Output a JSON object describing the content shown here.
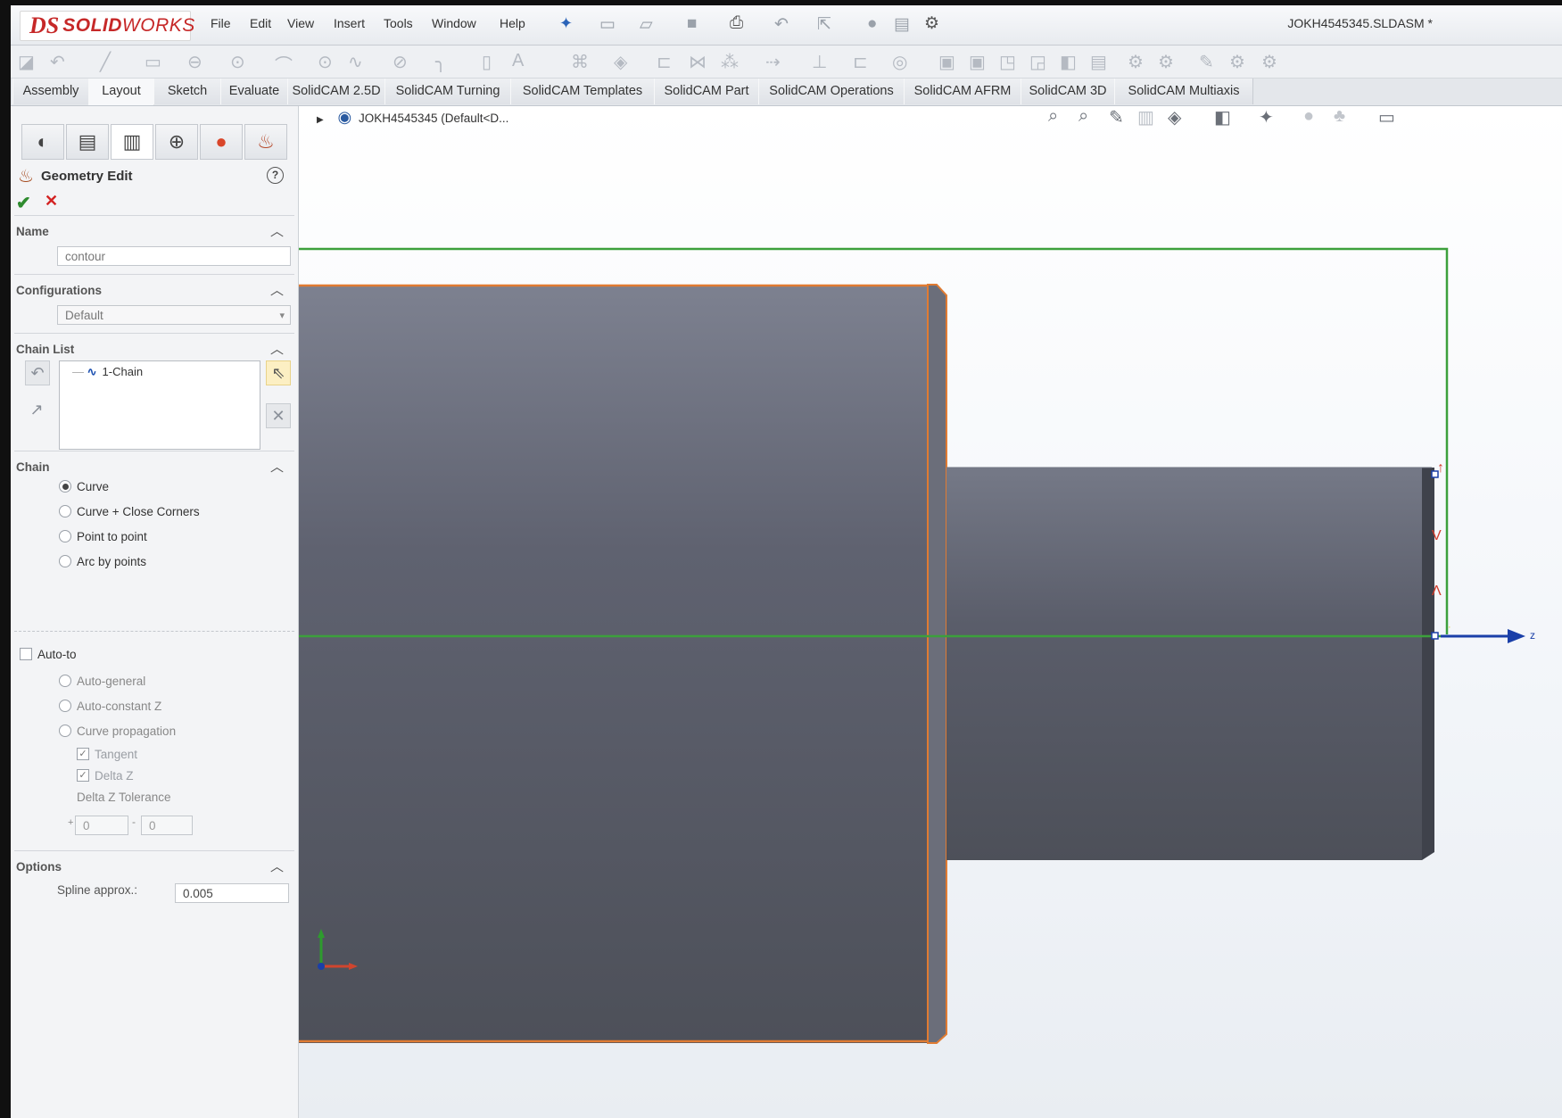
{
  "app": {
    "logo_ds": "DS",
    "logo_solid": "SOLID",
    "logo_works": "WORKS",
    "menu": [
      "File",
      "Edit",
      "View",
      "Insert",
      "Tools",
      "Window",
      "Help"
    ],
    "document_title": "JOKH4545345.SLDASM *"
  },
  "command_tabs": [
    "Assembly",
    "Layout",
    "Sketch",
    "Evaluate",
    "SolidCAM 2.5D",
    "SolidCAM Turning",
    "SolidCAM Templates",
    "SolidCAM Part",
    "SolidCAM Operations",
    "SolidCAM AFRM",
    "SolidCAM 3D",
    "SolidCAM Multiaxis"
  ],
  "active_tab": "Layout",
  "panel": {
    "title": "Geometry Edit",
    "name_section": {
      "label": "Name",
      "value": "contour"
    },
    "config_section": {
      "label": "Configurations",
      "value": "Default"
    },
    "chain_list": {
      "label": "Chain List",
      "items": [
        "1-Chain"
      ]
    },
    "chain": {
      "label": "Chain",
      "options": [
        "Curve",
        "Curve + Close Corners",
        "Point to point",
        "Arc by points"
      ],
      "selected": "Curve"
    },
    "auto_to": {
      "label": "Auto-to",
      "options": [
        "Auto-general",
        "Auto-constant Z",
        "Curve propagation"
      ],
      "tangent_label": "Tangent",
      "delta_z_label": "Delta Z",
      "tolerance_label": "Delta Z Tolerance",
      "tol_minus": "0",
      "tol_plus": "0",
      "tol_minus_sign": "-",
      "tol_plus_sign": "+"
    },
    "options": {
      "label": "Options",
      "spline_label": "Spline approx.:",
      "spline_value": "0.005"
    }
  },
  "viewport": {
    "breadcrumb": "JOKH4545345 (Default<D...",
    "axis_label": "z",
    "body_color": "#52555f",
    "edge_color": "#e07b32",
    "contour_color": "#3ca03c",
    "axis_color": "#1a3fa8"
  }
}
